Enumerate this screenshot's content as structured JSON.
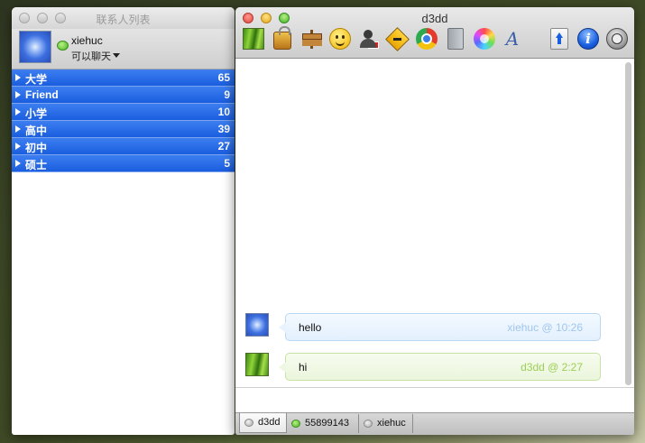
{
  "contacts_window": {
    "title": "联系人列表",
    "user": {
      "name": "xiehuc",
      "status": "可以聊天"
    },
    "groups": [
      {
        "name": "大学",
        "count": "65"
      },
      {
        "name": "Friend",
        "count": "9"
      },
      {
        "name": "小学",
        "count": "10"
      },
      {
        "name": "高中",
        "count": "39"
      },
      {
        "name": "初中",
        "count": "27"
      },
      {
        "name": "硕士",
        "count": "5"
      }
    ]
  },
  "chat_window": {
    "title": "d3dd",
    "toolbar_icons": [
      "grass-avatar-icon",
      "lock-icon",
      "signpost-icon",
      "smiley-icon",
      "block-user-icon",
      "direction-sign-icon",
      "chrome-icon",
      "phone-icon",
      "color-wheel-icon",
      "font-icon",
      "upload-icon",
      "info-icon",
      "clock-icon"
    ],
    "messages": [
      {
        "text": "hello",
        "meta": "xiehuc @ 10:26",
        "style": "blue"
      },
      {
        "text": "hi",
        "meta": "d3dd @ 2:27",
        "style": "green"
      }
    ],
    "input_value": "",
    "tabs": [
      {
        "label": "d3dd",
        "status": "offline",
        "active": true
      },
      {
        "label": "55899143",
        "status": "online",
        "active": false
      },
      {
        "label": "xiehuc",
        "status": "offline",
        "active": false
      }
    ]
  },
  "colors": {
    "group_blue": "#1a5ddf",
    "bubble_blue_meta": "#9fc7ee",
    "bubble_green_meta": "#9ccf54"
  }
}
